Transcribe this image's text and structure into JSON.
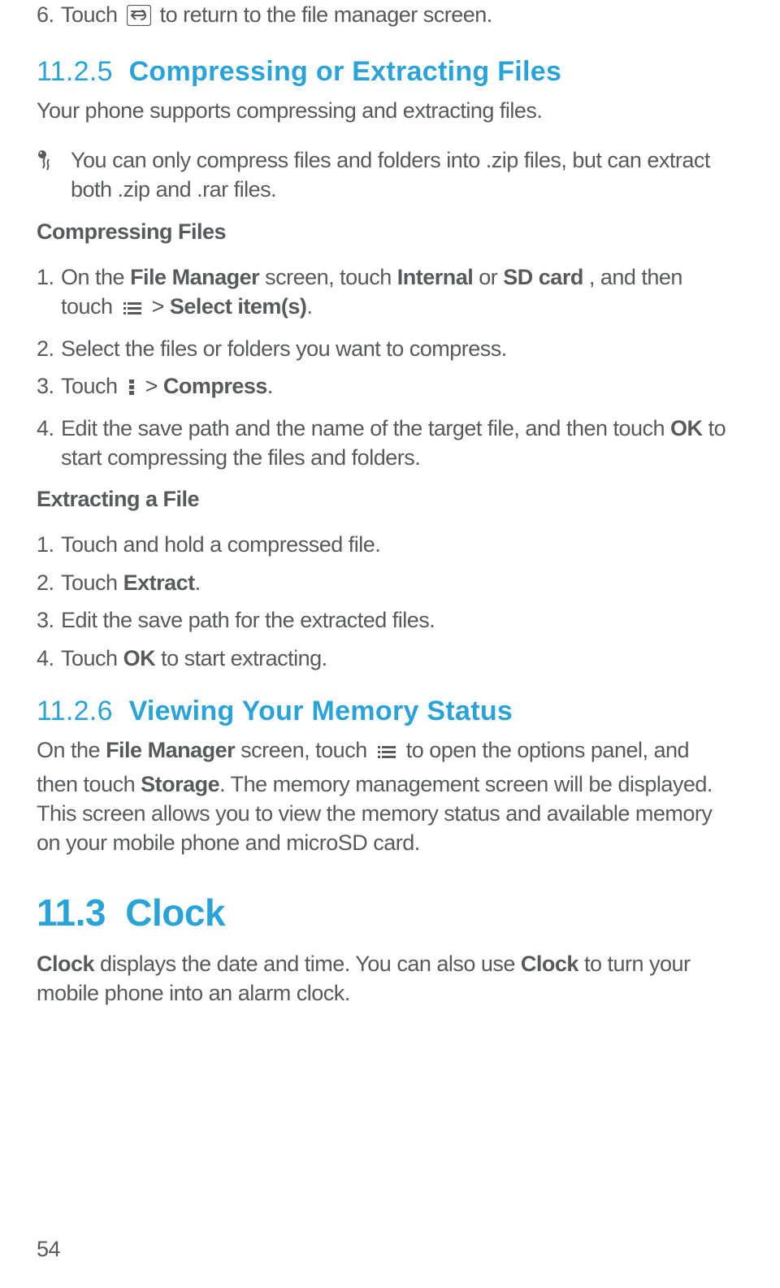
{
  "step6": {
    "num": "6.",
    "pre": " Touch ",
    "post": " to return to the file manager screen."
  },
  "s1125": {
    "num": "11.2.5",
    "title": "Compressing or Extracting Files",
    "intro": "Your phone supports compressing and extracting files.",
    "note": "You can only compress files and folders into .zip files, but can extract both .zip and .rar files."
  },
  "compress": {
    "heading": "Compressing Files",
    "step1": {
      "num": "1.",
      "t1": " On the ",
      "b1": "File Manager",
      "t2": " screen, touch ",
      "b2": "Internal",
      "t3": " or ",
      "b3": "SD card",
      "t4": ", and then touch ",
      "gt": " > ",
      "b4": "Select item(s)",
      "t5": "."
    },
    "step2": {
      "num": "2.",
      "t": " Select the files or folders you want to compress."
    },
    "step3": {
      "num": "3.",
      "t1": " Touch ",
      "gt": " > ",
      "b1": "Compress",
      "t2": "."
    },
    "step4": {
      "num": "4.",
      "t1": " Edit the save path and the name of the target file, and then touch ",
      "b1": "OK",
      "t2": " to start compressing the files and folders."
    }
  },
  "extract": {
    "heading": "Extracting a File",
    "step1": {
      "num": "1.",
      "t": " Touch and hold a compressed file."
    },
    "step2": {
      "num": "2.",
      "t1": " Touch ",
      "b1": "Extract",
      "t2": "."
    },
    "step3": {
      "num": "3.",
      "t": " Edit the save path for the extracted files."
    },
    "step4": {
      "num": "4.",
      "t1": " Touch ",
      "b1": "OK",
      "t2": " to start extracting."
    }
  },
  "s1126": {
    "num": "11.2.6",
    "title": "Viewing Your Memory Status",
    "t1": "On the ",
    "b1": "File Manager",
    "t2": " screen, touch ",
    "t3": " to open the options panel, and then touch ",
    "b2": "Storage",
    "t4": ". The memory management screen will be displayed. This screen allows you to view the memory status and available memory on your mobile phone and microSD card."
  },
  "s113": {
    "num": "11.3",
    "title": "Clock",
    "b1": "Clock",
    "t1": " displays the date and time. You can also use ",
    "b2": "Clock",
    "t2": " to turn your mobile phone into an alarm clock."
  },
  "pageNumber": "54"
}
